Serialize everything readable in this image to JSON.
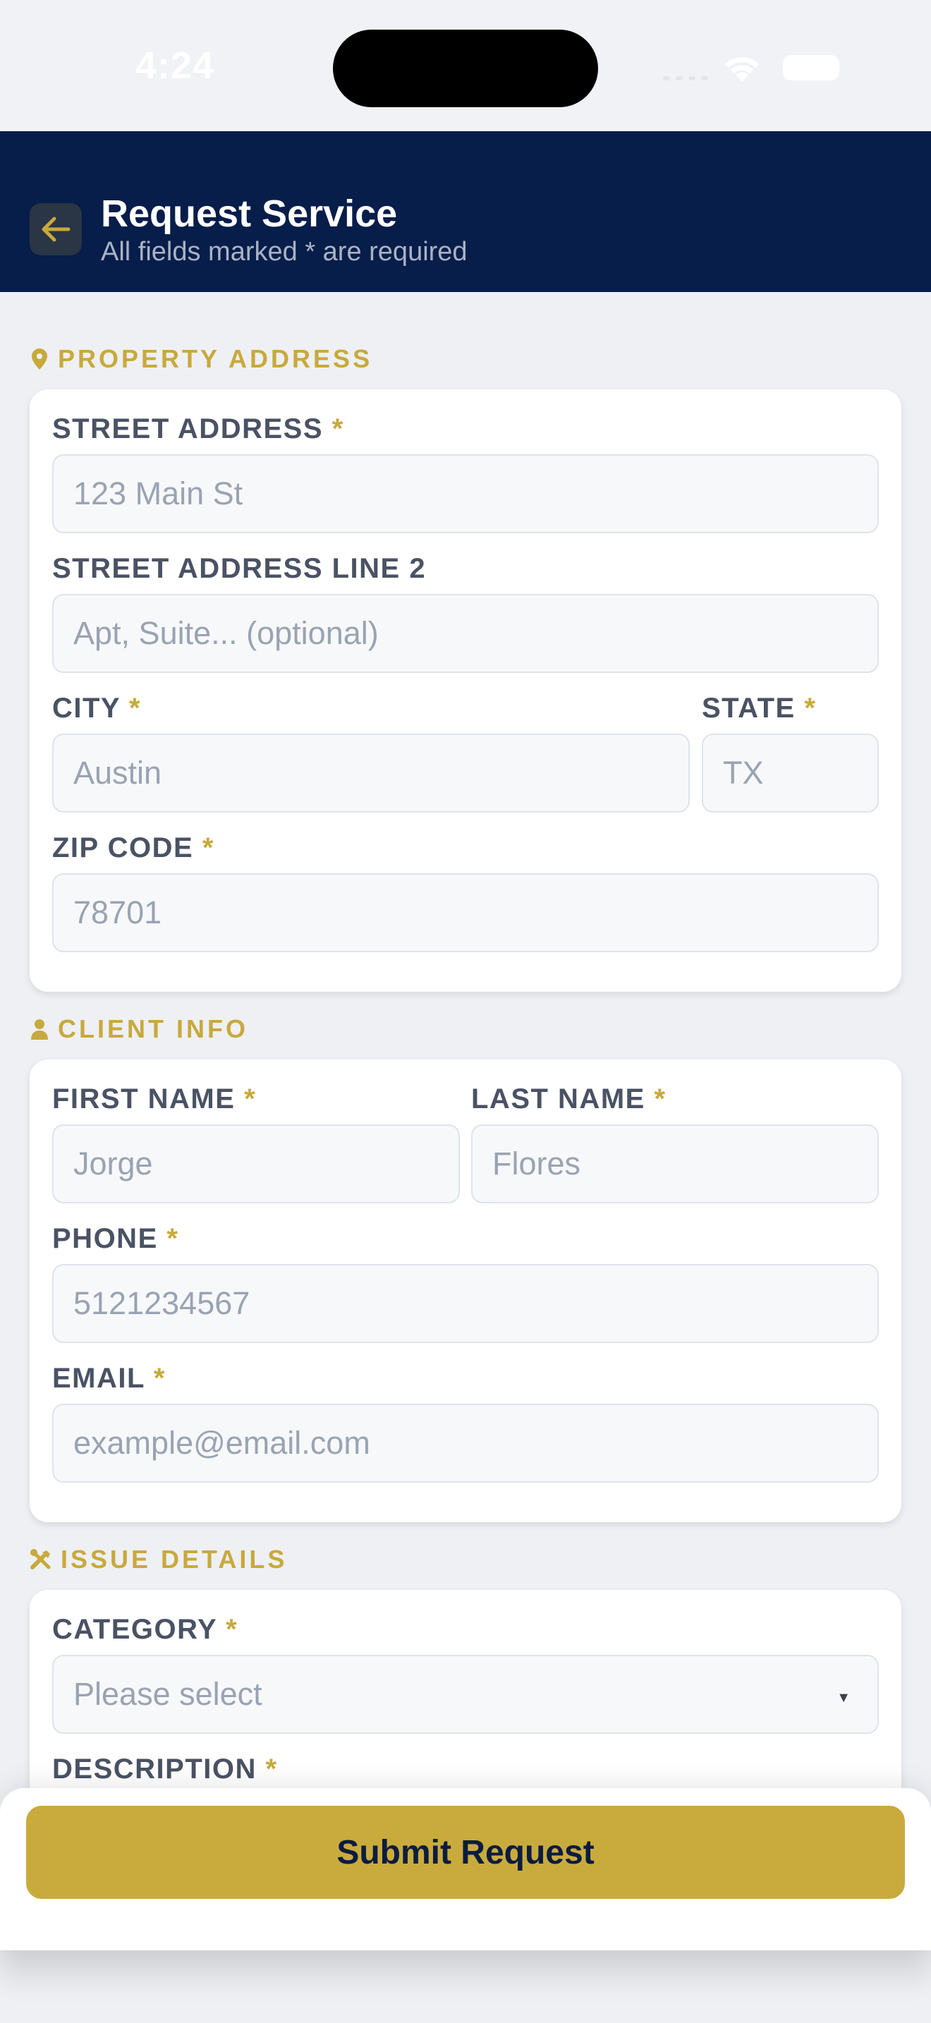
{
  "status_bar": {
    "time": "4:24"
  },
  "header": {
    "title": "Request Service",
    "subtitle": "All fields marked * are required",
    "back_icon": "arrow-left-icon"
  },
  "sections": {
    "property": {
      "label": "PROPERTY ADDRESS",
      "icon": "map-pin-icon",
      "fields": {
        "street": {
          "label": "STREET ADDRESS",
          "required_mark": "*",
          "placeholder": "123 Main St",
          "value": ""
        },
        "street2": {
          "label": "STREET ADDRESS LINE 2",
          "placeholder": "Apt, Suite... (optional)",
          "value": ""
        },
        "city": {
          "label": "CITY",
          "required_mark": "*",
          "placeholder": "Austin",
          "value": ""
        },
        "state": {
          "label": "STATE",
          "required_mark": "*",
          "placeholder": "TX",
          "value": ""
        },
        "zip": {
          "label": "ZIP CODE",
          "required_mark": "*",
          "placeholder": "78701",
          "value": ""
        }
      }
    },
    "client": {
      "label": "CLIENT INFO",
      "icon": "user-icon",
      "fields": {
        "first_name": {
          "label": "FIRST NAME",
          "required_mark": "*",
          "placeholder": "Jorge",
          "value": ""
        },
        "last_name": {
          "label": "LAST NAME",
          "required_mark": "*",
          "placeholder": "Flores",
          "value": ""
        },
        "phone": {
          "label": "PHONE",
          "required_mark": "*",
          "placeholder": "5121234567",
          "value": ""
        },
        "email": {
          "label": "EMAIL",
          "required_mark": "*",
          "placeholder": "example@email.com",
          "value": ""
        }
      }
    },
    "issue": {
      "label": "ISSUE DETAILS",
      "icon": "tools-icon",
      "fields": {
        "category": {
          "label": "CATEGORY",
          "required_mark": "*",
          "selected": "Please select"
        },
        "description": {
          "label": "DESCRIPTION",
          "required_mark": "*"
        }
      }
    }
  },
  "submit": {
    "label": "Submit Request"
  },
  "colors": {
    "navy": "#071d4a",
    "gold": "#c8a93c",
    "button_gold": "#c9ab3d",
    "background": "#eef0f4"
  }
}
